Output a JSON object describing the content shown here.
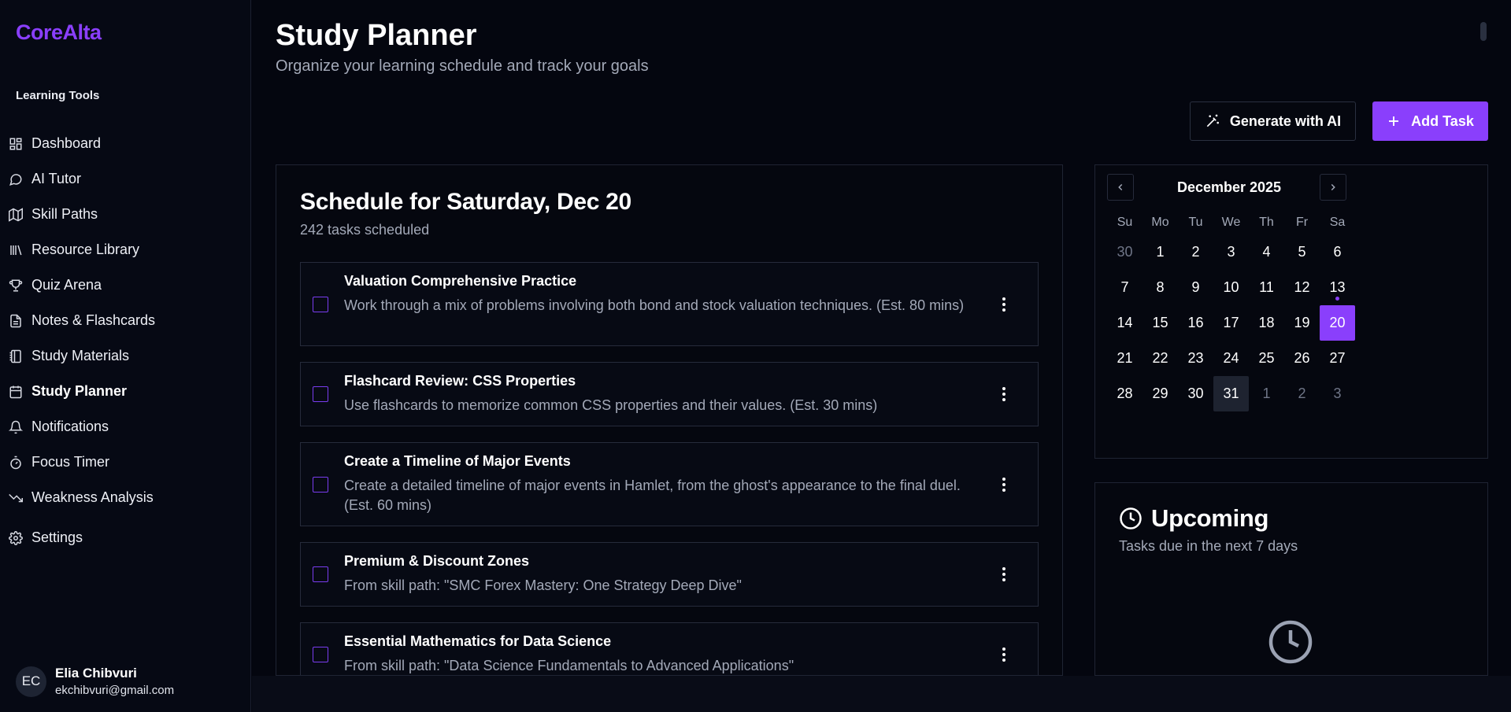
{
  "brand": {
    "name": "CoreAlta",
    "accent": "#8a3ffc"
  },
  "sidebar": {
    "section_label": "Learning Tools",
    "items": [
      {
        "label": "Dashboard",
        "icon": "dashboard-icon"
      },
      {
        "label": "AI Tutor",
        "icon": "chat-icon"
      },
      {
        "label": "Skill Paths",
        "icon": "map-icon"
      },
      {
        "label": "Resource Library",
        "icon": "library-icon"
      },
      {
        "label": "Quiz Arena",
        "icon": "trophy-icon"
      },
      {
        "label": "Notes & Flashcards",
        "icon": "notes-icon"
      },
      {
        "label": "Study Materials",
        "icon": "notebook-icon"
      },
      {
        "label": "Study Planner",
        "icon": "calendar-icon",
        "active": true
      },
      {
        "label": "Notifications",
        "icon": "bell-icon"
      },
      {
        "label": "Focus Timer",
        "icon": "timer-icon"
      },
      {
        "label": "Weakness Analysis",
        "icon": "trending-down-icon"
      }
    ],
    "settings": {
      "label": "Settings",
      "icon": "gear-icon"
    },
    "user": {
      "initials": "EC",
      "name": "Elia Chibvuri",
      "email": "ekchibvuri@gmail.com"
    }
  },
  "header": {
    "title": "Study Planner",
    "subtitle": "Organize your learning schedule and track your goals"
  },
  "actions": {
    "generate_label": "Generate with AI",
    "add_label": "Add Task"
  },
  "schedule": {
    "title": "Schedule for Saturday, Dec 20",
    "count_text": "242 tasks scheduled",
    "tasks": [
      {
        "title": "Valuation Comprehensive Practice",
        "description": "Work through a mix of problems involving both bond and stock valuation techniques. (Est. 80 mins)"
      },
      {
        "title": "Flashcard Review: CSS Properties",
        "description": "Use flashcards to memorize common CSS properties and their values. (Est. 30 mins)"
      },
      {
        "title": "Create a Timeline of Major Events",
        "description": "Create a detailed timeline of major events in Hamlet, from the ghost's appearance to the final duel. (Est. 60 mins)"
      },
      {
        "title": "Premium & Discount Zones",
        "description": "From skill path: \"SMC Forex Mastery: One Strategy Deep Dive\""
      },
      {
        "title": "Essential Mathematics for Data Science",
        "description": "From skill path: \"Data Science Fundamentals to Advanced Applications\""
      }
    ]
  },
  "calendar": {
    "month_label": "December 2025",
    "weekdays": [
      "Su",
      "Mo",
      "Tu",
      "We",
      "Th",
      "Fr",
      "Sa"
    ],
    "days": [
      {
        "n": "30",
        "out": true
      },
      {
        "n": "1"
      },
      {
        "n": "2"
      },
      {
        "n": "3"
      },
      {
        "n": "4"
      },
      {
        "n": "5"
      },
      {
        "n": "6"
      },
      {
        "n": "7"
      },
      {
        "n": "8"
      },
      {
        "n": "9"
      },
      {
        "n": "10"
      },
      {
        "n": "11"
      },
      {
        "n": "12"
      },
      {
        "n": "13",
        "dot": true
      },
      {
        "n": "14"
      },
      {
        "n": "15"
      },
      {
        "n": "16"
      },
      {
        "n": "17"
      },
      {
        "n": "18"
      },
      {
        "n": "19"
      },
      {
        "n": "20",
        "selected": true
      },
      {
        "n": "21"
      },
      {
        "n": "22"
      },
      {
        "n": "23"
      },
      {
        "n": "24"
      },
      {
        "n": "25"
      },
      {
        "n": "26"
      },
      {
        "n": "27"
      },
      {
        "n": "28"
      },
      {
        "n": "29"
      },
      {
        "n": "30"
      },
      {
        "n": "31",
        "today": true
      },
      {
        "n": "1",
        "out": true
      },
      {
        "n": "2",
        "out": true
      },
      {
        "n": "3",
        "out": true
      }
    ]
  },
  "upcoming": {
    "title": "Upcoming",
    "subtitle": "Tasks due in the next 7 days"
  }
}
